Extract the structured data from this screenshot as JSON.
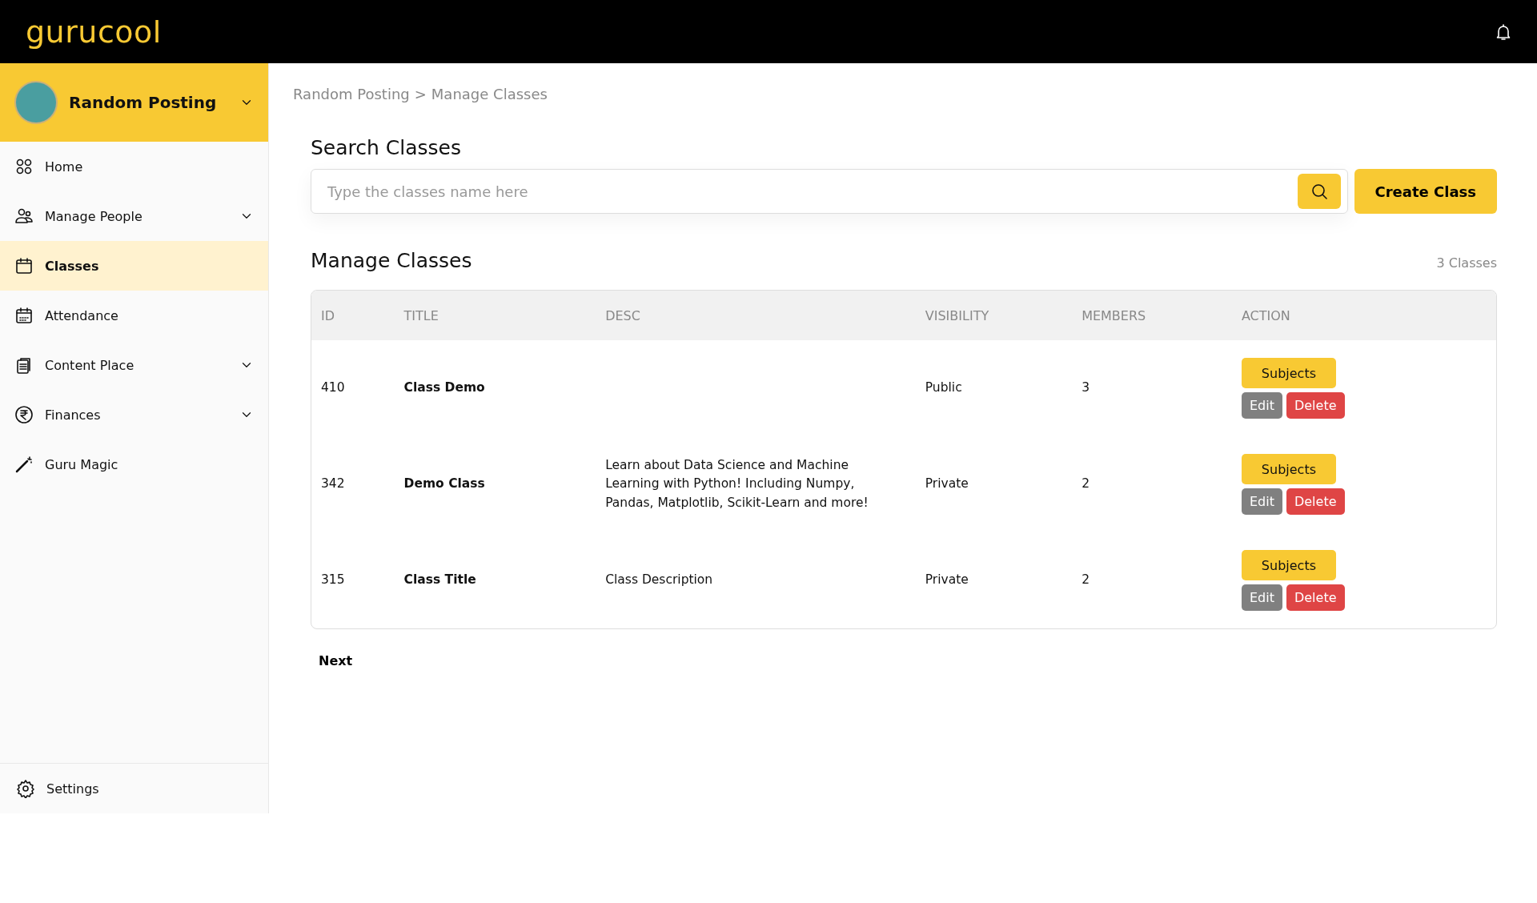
{
  "header": {
    "logo": "gurucool"
  },
  "sidebar": {
    "account": {
      "name": "Random Posting"
    },
    "items": [
      {
        "kind": "grid",
        "label": "Home",
        "selected": false,
        "expandable": false
      },
      {
        "kind": "people",
        "label": "Manage People",
        "selected": false,
        "expandable": true
      },
      {
        "kind": "calendar",
        "label": "Classes",
        "selected": true,
        "expandable": false
      },
      {
        "kind": "attendance",
        "label": "Attendance",
        "selected": false,
        "expandable": false
      },
      {
        "kind": "clipboard",
        "label": "Content Place",
        "selected": false,
        "expandable": true
      },
      {
        "kind": "rupee",
        "label": "Finances",
        "selected": false,
        "expandable": true
      },
      {
        "kind": "wand",
        "label": "Guru Magic",
        "selected": false,
        "expandable": false
      }
    ],
    "settings": {
      "label": "Settings"
    }
  },
  "breadcrumb": [
    "Random Posting",
    "Manage Classes"
  ],
  "breadcrumb_separator": ">",
  "search": {
    "title": "Search Classes",
    "placeholder": "Type the classes name here",
    "create_button": "Create Class"
  },
  "table": {
    "title": "Manage Classes",
    "count": "3 Classes",
    "columns": [
      "ID",
      "TITLE",
      "DESC",
      "VISIBILITY",
      "MEMBERS",
      "ACTION"
    ],
    "rows": [
      {
        "id": "410",
        "title": "Class Demo",
        "desc": "",
        "visibility": "Public",
        "members": "3",
        "actions": [
          {
            "kind": "subjects",
            "label": "Subjects"
          },
          {
            "kind": "edit",
            "label": "Edit"
          },
          {
            "kind": "delete",
            "label": "Delete"
          }
        ]
      },
      {
        "id": "342",
        "title": "Demo Class",
        "desc": "Learn about Data Science and Machine Learning with Python! Including Numpy, Pandas, Matplotlib, Scikit-Learn and more!",
        "visibility": "Private",
        "members": "2",
        "actions": [
          {
            "kind": "subjects",
            "label": "Subjects"
          },
          {
            "kind": "edit",
            "label": "Edit"
          },
          {
            "kind": "delete",
            "label": "Delete"
          }
        ]
      },
      {
        "id": "315",
        "title": "Class Title",
        "desc": "Class Description",
        "visibility": "Private",
        "members": "2",
        "actions": [
          {
            "kind": "subjects",
            "label": "Subjects"
          },
          {
            "kind": "edit",
            "label": "Edit"
          },
          {
            "kind": "delete",
            "label": "Delete"
          }
        ]
      }
    ]
  },
  "pagination": {
    "next": "Next"
  }
}
